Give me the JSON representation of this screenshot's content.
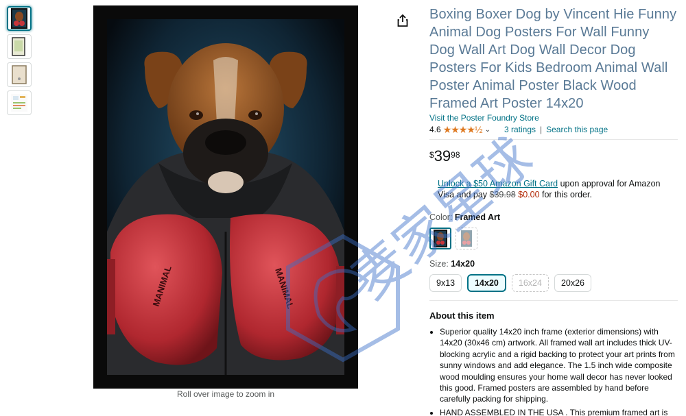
{
  "product": {
    "title": "Boxing Boxer Dog by Vincent Hie Funny Animal Dog Posters For Wall Funny Dog Wall Art Dog Wall Decor Dog Posters For Kids Bedroom Animal Wall Poster Animal Poster Black Wood Framed Art Poster 14x20",
    "store_link": "Visit the Poster Foundry Store",
    "rating_value": "4.6",
    "stars_glyph": "★★★★½",
    "ratings_count": "3 ratings",
    "search_page": "Search this page",
    "separator": "|"
  },
  "price": {
    "symbol": "$",
    "whole": "39",
    "fraction": "98"
  },
  "gift": {
    "link_text": "Unlock a $50 Amazon Gift Card",
    "text_1": " upon approval for Amazon Visa and pay ",
    "old_price": "$39.98",
    "new_price": "$0.00",
    "text_2": " for this order."
  },
  "color": {
    "label": "Color:",
    "value": "Framed Art"
  },
  "size": {
    "label": "Size:",
    "value": "14x20",
    "options": [
      "9x13",
      "14x20",
      "16x24",
      "20x26"
    ]
  },
  "image": {
    "zoom_hint": "Roll over image to zoom in",
    "glove_text": "MANIMAL"
  },
  "about": {
    "heading": "About this item",
    "bullets": [
      "Superior quality 14x20 inch frame (exterior dimensions) with 14x20 (30x46 cm) artwork. All framed wall art includes thick UV-blocking acrylic and a rigid backing to protect your art prints from sunny windows and add elegance. The 1.5 inch wide composite wood moulding ensures your home wall decor has never looked this good. Framed posters are assembled by hand before carefully packing for shipping.",
      "HAND ASSEMBLED IN THE USA . This premium framed art is"
    ]
  },
  "watermark": {
    "text": "麦家星球"
  },
  "colors": {
    "link": "#007185",
    "title": "#5a7a96",
    "star": "#de7921",
    "deal": "#b12704",
    "watermark": "#3a6fc8"
  }
}
